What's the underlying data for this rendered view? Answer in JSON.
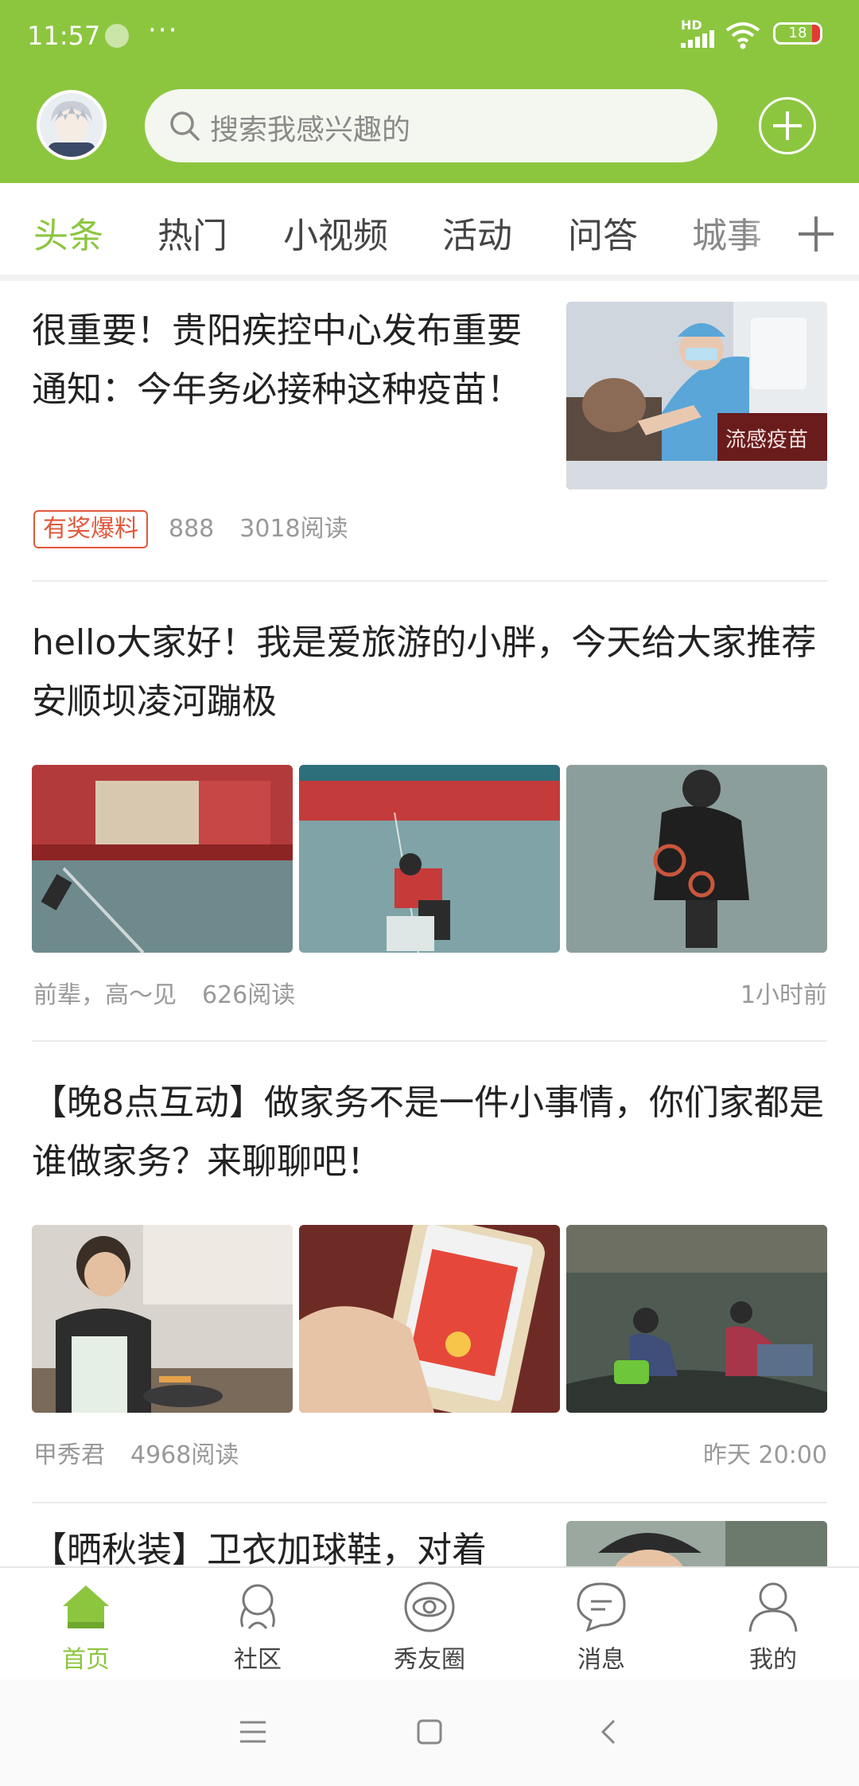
{
  "status_bar": {
    "time": "11:57",
    "more": "···",
    "network": "HD",
    "battery": "18"
  },
  "header": {
    "search_placeholder": "搜索我感兴趣的"
  },
  "tabs": [
    {
      "label": "头条",
      "active": true
    },
    {
      "label": "热门"
    },
    {
      "label": "小视频"
    },
    {
      "label": "活动"
    },
    {
      "label": "问答"
    },
    {
      "label": "城事"
    }
  ],
  "feed": [
    {
      "title": "很重要！贵阳疾控中心发布重要通知：今年务必接种这种疫苗！",
      "badge": "有奖爆料",
      "count": "888",
      "reads": "3018阅读",
      "image_sign_text": "流感疫苗"
    },
    {
      "title": "hello大家好！我是爱旅游的小胖，今天给大家推荐安顺坝凌河蹦极",
      "author": "前辈，高～见",
      "reads": "626阅读",
      "time": "1小时前"
    },
    {
      "title": "【晚8点互动】做家务不是一件小事情，你们家都是谁做家务？来聊聊吧！",
      "author": "甲秀君",
      "reads": "4968阅读",
      "time": "昨天 20:00"
    },
    {
      "title": "【晒秋装】卫衣加球鞋，对着"
    }
  ],
  "bottom_nav": [
    {
      "label": "首页",
      "icon": "home-icon",
      "active": true
    },
    {
      "label": "社区",
      "icon": "community-icon"
    },
    {
      "label": "秀友圈",
      "icon": "circle-icon"
    },
    {
      "label": "消息",
      "icon": "message-icon"
    },
    {
      "label": "我的",
      "icon": "profile-icon"
    }
  ],
  "colors": {
    "brand": "#8cc63f",
    "badge": "#e0583b"
  }
}
